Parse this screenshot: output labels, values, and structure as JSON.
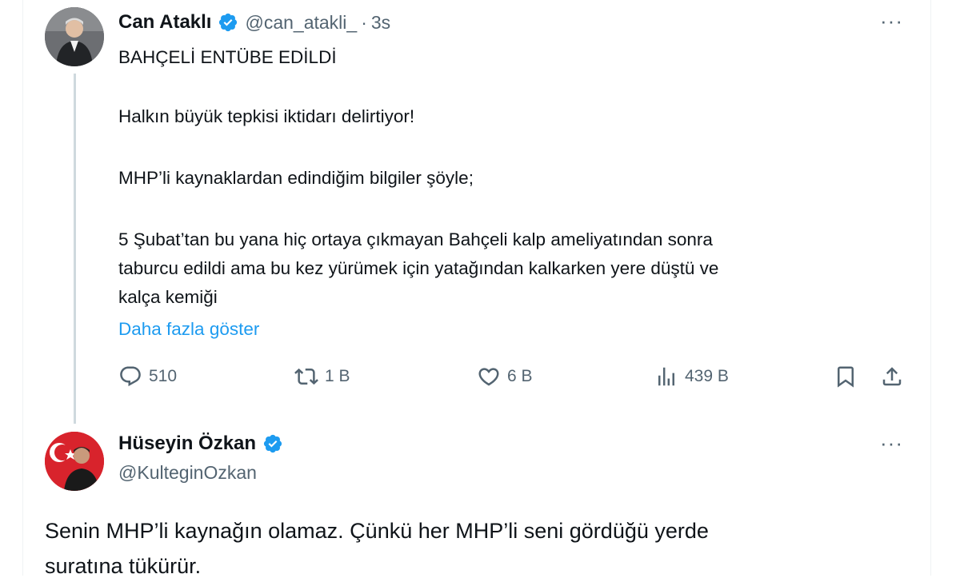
{
  "tweet1": {
    "author_name": "Can Ataklı",
    "handle": "@can_atakli_",
    "separator": "·",
    "time": "3s",
    "more_label": "···",
    "lines": [
      "BAHÇELİ ENTÜBE EDİLDİ",
      "Halkın büyük tepkisi iktidarı delirtiyor!",
      "MHP’li kaynaklardan edindiğim bilgiler şöyle;",
      "5 Şubat’tan bu yana hiç ortaya çıkmayan Bahçeli kalp ameliyatından sonra",
      "taburcu edildi ama bu kez yürümek için yatağından kalkarken yere düştü ve",
      "kalça kemiği"
    ],
    "show_more": "Daha fazla göster",
    "actions": {
      "reply": "510",
      "retweet": "1 B",
      "like": "6 B",
      "views": "439 B"
    }
  },
  "tweet2": {
    "author_name": "Hüseyin Özkan",
    "handle": "@KulteginOzkan",
    "more_label": "···",
    "lines": [
      "Senin MHP’li kaynağın olamaz. Çünkü her MHP’li seni gördüğü yerde",
      "suratına tükürür."
    ]
  },
  "colors": {
    "verified": "#1d9bf0",
    "link": "#1d9bf0",
    "secondary_text": "#536471"
  }
}
